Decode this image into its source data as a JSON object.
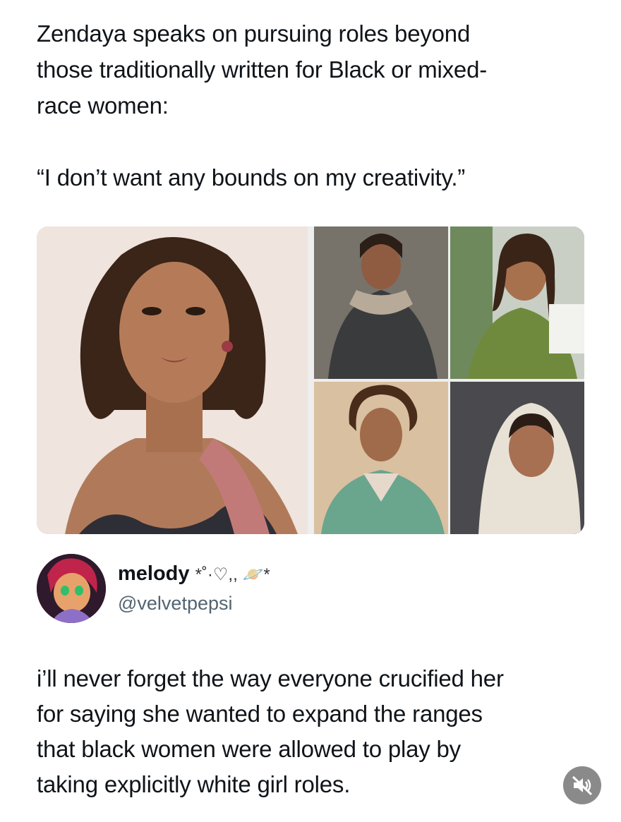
{
  "post": {
    "text": "Zendaya speaks on pursuing roles beyond\nthose traditionally written for Black or mixed-\nrace women:\n\n“I don’t want any bounds on my creativity.”"
  },
  "media": {
    "images": [
      {
        "label": "portrait-main"
      },
      {
        "label": "still-desert-costume"
      },
      {
        "label": "still-green-dress"
      },
      {
        "label": "still-teal-uniform"
      },
      {
        "label": "still-white-headscarf"
      }
    ]
  },
  "reply": {
    "display_name": "melody",
    "name_decoration": "*˚·♡,, 🪐*",
    "handle": "@velvetpepsi",
    "text": "i’ll never forget the way everyone crucified her\nfor saying she wanted to expand the ranges\nthat black women were allowed to play by\ntaking explicitly white girl roles."
  },
  "controls": {
    "mute_icon": "speaker-muted-icon"
  }
}
